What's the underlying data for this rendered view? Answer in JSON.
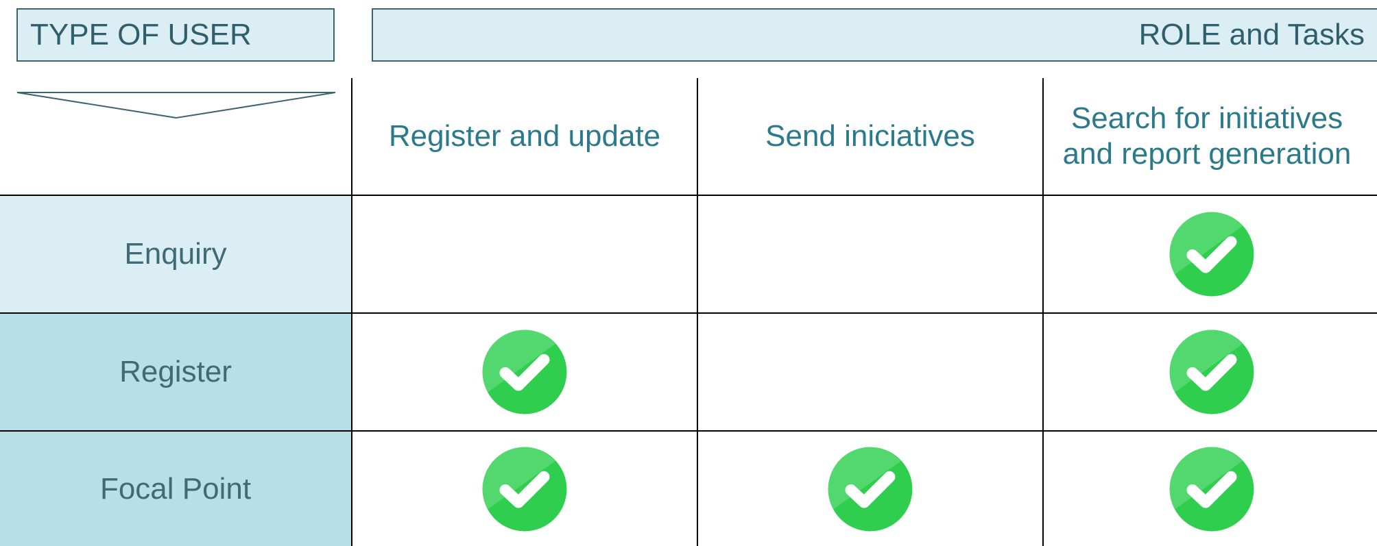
{
  "header": {
    "type_of_user": "TYPE OF USER",
    "role_tasks": "ROLE and Tasks"
  },
  "columns": [
    {
      "label": "Register and update"
    },
    {
      "label": "Send iniciatives"
    },
    {
      "label": "Search for initiatives and report generation"
    }
  ],
  "rows": [
    {
      "label": "Enquiry",
      "checks": [
        false,
        false,
        true
      ]
    },
    {
      "label": "Register",
      "checks": [
        true,
        false,
        true
      ]
    },
    {
      "label": "Focal Point",
      "checks": [
        true,
        true,
        true
      ]
    }
  ],
  "colors": {
    "header_box_fill": "#dbeef4",
    "row_enquiry_fill": "#daeef3",
    "row_register_fill": "#b8dfe8",
    "check_green": "#2fce4e",
    "heading_teal": "#2b7a8c"
  },
  "icons": {
    "check": "green-checkmark-icon"
  }
}
